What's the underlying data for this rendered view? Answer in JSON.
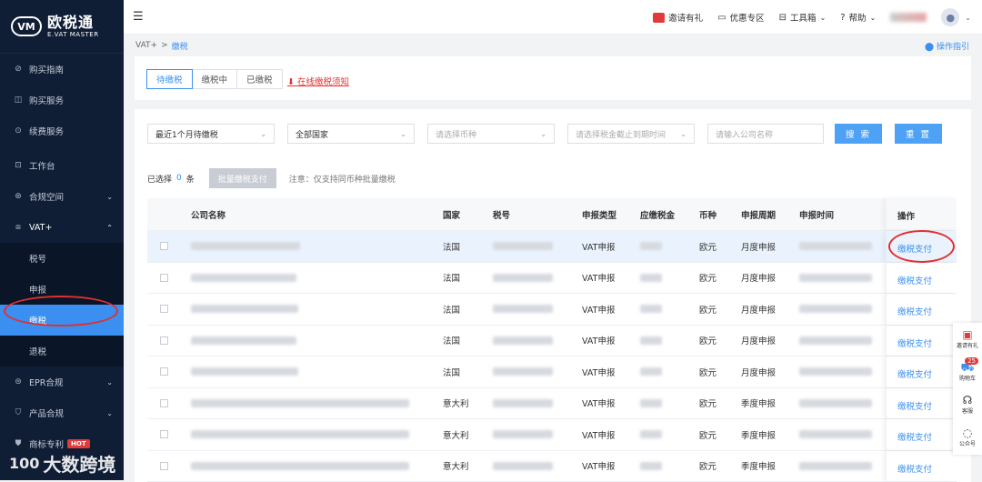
{
  "brand": {
    "logo_mark": "VM",
    "name_cn": "欧税通",
    "name_en": "E.VAT MASTER"
  },
  "sidebar": {
    "items": [
      {
        "label": "购买指南",
        "icon": "compass-icon",
        "glyph": "⊘"
      },
      {
        "label": "购买服务",
        "icon": "bag-icon",
        "glyph": "◫"
      },
      {
        "label": "续费服务",
        "icon": "renew-icon",
        "glyph": "⊙"
      },
      {
        "label": "工作台",
        "icon": "dashboard-icon",
        "glyph": "⊡"
      },
      {
        "label": "合规空间",
        "icon": "shield-icon",
        "glyph": "⊛"
      },
      {
        "label": "VAT+",
        "icon": "briefcase-icon",
        "glyph": "⧈"
      }
    ],
    "vat_sub": [
      "税号",
      "申报",
      "缴税",
      "退税"
    ],
    "items_after": [
      {
        "label": "EPR合规",
        "icon": "epr-icon",
        "glyph": "⊜"
      },
      {
        "label": "产品合规",
        "icon": "product-shield-icon",
        "glyph": "⛉"
      },
      {
        "label": "商标专利",
        "icon": "trademark-icon",
        "glyph": "⛊"
      }
    ],
    "hot_badge": "HOT"
  },
  "topbar": {
    "invite": "邀请有礼",
    "offers": "优惠专区",
    "toolbox": "工具箱",
    "help": "帮助"
  },
  "breadcrumb": {
    "parent": "VAT+",
    "sep": ">",
    "current": "缴税"
  },
  "guide_link": "操作指引",
  "tabs": [
    "待缴税",
    "缴税中",
    "已缴税"
  ],
  "notice_link": "在线缴税须知",
  "filters": {
    "period": "最近1个月待缴税",
    "country": "全部国家",
    "currency_ph": "请选择币种",
    "deadline_ph": "请选择税金截止到期时间",
    "company_ph": "请输入公司名称",
    "search": "搜 索",
    "reset": "重 置"
  },
  "selection": {
    "prefix": "已选择",
    "count": "0",
    "unit": "条",
    "batch_btn": "批量缴税支付",
    "note": "注意：仅支持同币种批量缴税"
  },
  "table": {
    "headers": [
      "公司名称",
      "国家",
      "税号",
      "申报类型",
      "应缴税金",
      "币种",
      "申报周期",
      "申报时间",
      "操作"
    ],
    "rows": [
      {
        "country": "法国",
        "type": "VAT申报",
        "currency": "欧元",
        "period": "月度申报",
        "action": "缴税支付"
      },
      {
        "country": "法国",
        "type": "VAT申报",
        "currency": "欧元",
        "period": "月度申报",
        "action": "缴税支付"
      },
      {
        "country": "法国",
        "type": "VAT申报",
        "currency": "欧元",
        "period": "月度申报",
        "action": "缴税支付"
      },
      {
        "country": "法国",
        "type": "VAT申报",
        "currency": "欧元",
        "period": "月度申报",
        "action": "缴税支付"
      },
      {
        "country": "法国",
        "type": "VAT申报",
        "currency": "欧元",
        "period": "月度申报",
        "action": "缴税支付"
      },
      {
        "country": "意大利",
        "type": "VAT申报",
        "currency": "欧元",
        "period": "季度申报",
        "action": "缴税支付"
      },
      {
        "country": "意大利",
        "type": "VAT申报",
        "currency": "欧元",
        "period": "季度申报",
        "action": "缴税支付"
      },
      {
        "country": "意大利",
        "type": "VAT申报",
        "currency": "欧元",
        "period": "季度申报",
        "action": "缴税支付"
      }
    ]
  },
  "float_bar": {
    "invite": "邀请有礼",
    "cart": "购物车",
    "cart_count": "25",
    "service": "客服",
    "wechat": "公众号"
  },
  "watermark": {
    "num": "100",
    "text": "大数跨境"
  }
}
